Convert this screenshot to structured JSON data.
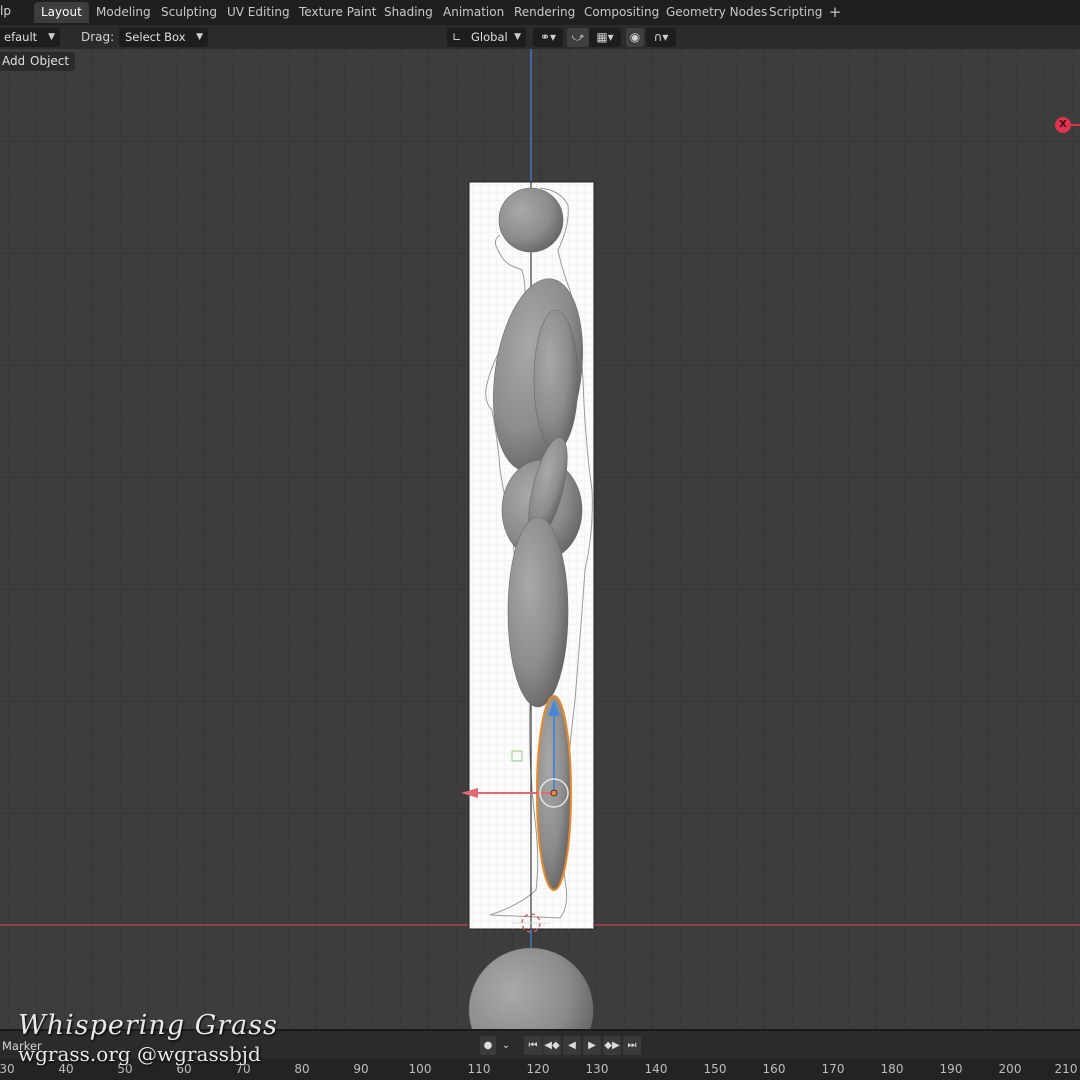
{
  "menu": {
    "help_fragment": "lp"
  },
  "workspace_tabs": [
    {
      "label": "Layout",
      "active": true
    },
    {
      "label": "Modeling",
      "active": false
    },
    {
      "label": "Sculpting",
      "active": false
    },
    {
      "label": "UV Editing",
      "active": false
    },
    {
      "label": "Texture Paint",
      "active": false
    },
    {
      "label": "Shading",
      "active": false
    },
    {
      "label": "Animation",
      "active": false
    },
    {
      "label": "Rendering",
      "active": false
    },
    {
      "label": "Compositing",
      "active": false
    },
    {
      "label": "Geometry Nodes",
      "active": false
    },
    {
      "label": "Scripting",
      "active": false
    }
  ],
  "add_tab_symbol": "+",
  "toolbar": {
    "orientation_value": "efault",
    "drag_label": "Drag:",
    "drag_value": "Select Box",
    "transform_orientation": "Global"
  },
  "viewport_header": {
    "add_label": "Add",
    "object_label": "Object"
  },
  "navigation_gizmo": {
    "x_label": "X"
  },
  "timeline": {
    "marker_label": "Marker",
    "frame_ticks": [
      "30",
      "40",
      "50",
      "60",
      "70",
      "80",
      "90",
      "100",
      "110",
      "120",
      "130",
      "140",
      "150",
      "160",
      "170",
      "180",
      "190",
      "200",
      "210"
    ]
  },
  "watermark": {
    "line1": "Whispering Grass",
    "line2": "wgrass.org @wgrassbjd"
  },
  "colors": {
    "accent_active_tab": "#3d3d3d",
    "x_axis": "#c9444f",
    "z_axis": "#4a86d6",
    "selection_outline": "#e8882a"
  }
}
